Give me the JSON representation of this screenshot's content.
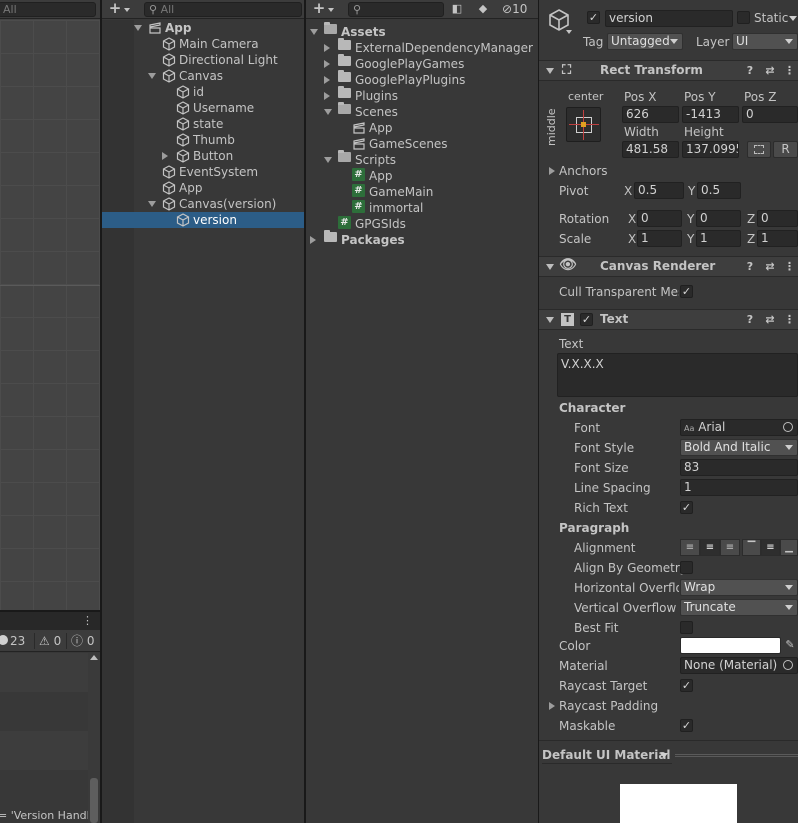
{
  "scene": {
    "search_placeholder": "All"
  },
  "console": {
    "warn_badge_count": "23",
    "warn_count": "0",
    "error_count": "0",
    "log_message": "= 'Version Handl"
  },
  "hierarchy": {
    "search_placeholder": "All",
    "items": [
      {
        "label": "App",
        "depth": 0,
        "expand": "down",
        "icon": "unity-scene-icon",
        "bold": true
      },
      {
        "label": "Main Camera",
        "depth": 1,
        "expand": "",
        "icon": "gameobject-cube-icon"
      },
      {
        "label": "Directional Light",
        "depth": 1,
        "expand": "",
        "icon": "gameobject-cube-icon"
      },
      {
        "label": "Canvas",
        "depth": 1,
        "expand": "down",
        "icon": "gameobject-cube-icon"
      },
      {
        "label": "id",
        "depth": 2,
        "expand": "",
        "icon": "gameobject-cube-icon"
      },
      {
        "label": "Username",
        "depth": 2,
        "expand": "",
        "icon": "gameobject-cube-icon"
      },
      {
        "label": "state",
        "depth": 2,
        "expand": "",
        "icon": "gameobject-cube-icon"
      },
      {
        "label": "Thumb",
        "depth": 2,
        "expand": "",
        "icon": "gameobject-cube-icon"
      },
      {
        "label": "Button",
        "depth": 2,
        "expand": "right",
        "icon": "gameobject-cube-icon"
      },
      {
        "label": "EventSystem",
        "depth": 1,
        "expand": "",
        "icon": "gameobject-cube-icon"
      },
      {
        "label": "App",
        "depth": 1,
        "expand": "",
        "icon": "gameobject-cube-icon"
      },
      {
        "label": "Canvas(version)",
        "depth": 1,
        "expand": "down",
        "icon": "gameobject-cube-icon"
      },
      {
        "label": "version",
        "depth": 2,
        "expand": "",
        "icon": "gameobject-cube-icon",
        "selected": true
      }
    ]
  },
  "project": {
    "hidden_count": "10",
    "items": [
      {
        "label": "Assets",
        "depth": 0,
        "expand": "down",
        "icon": "folder-open-icon",
        "bold": true
      },
      {
        "label": "ExternalDependencyManager",
        "depth": 1,
        "expand": "right",
        "icon": "folder-icon"
      },
      {
        "label": "GooglePlayGames",
        "depth": 1,
        "expand": "right",
        "icon": "folder-icon"
      },
      {
        "label": "GooglePlayPlugins",
        "depth": 1,
        "expand": "right",
        "icon": "folder-icon"
      },
      {
        "label": "Plugins",
        "depth": 1,
        "expand": "right",
        "icon": "folder-icon"
      },
      {
        "label": "Scenes",
        "depth": 1,
        "expand": "down",
        "icon": "folder-open-icon"
      },
      {
        "label": "App",
        "depth": 2,
        "expand": "",
        "icon": "unity-scene-icon"
      },
      {
        "label": "GameScenes",
        "depth": 2,
        "expand": "",
        "icon": "unity-scene-icon"
      },
      {
        "label": "Scripts",
        "depth": 1,
        "expand": "down",
        "icon": "folder-open-icon"
      },
      {
        "label": "App",
        "depth": 2,
        "expand": "",
        "icon": "csharp-script-icon"
      },
      {
        "label": "GameMain",
        "depth": 2,
        "expand": "",
        "icon": "csharp-script-icon"
      },
      {
        "label": "immortal",
        "depth": 2,
        "expand": "",
        "icon": "csharp-script-icon"
      },
      {
        "label": "GPGSIds",
        "depth": 1,
        "expand": "",
        "icon": "csharp-script-icon"
      },
      {
        "label": "Packages",
        "depth": 0,
        "expand": "right",
        "icon": "folder-icon",
        "bold": true
      }
    ]
  },
  "inspector": {
    "name": "version",
    "static_label": "Static",
    "tag_label": "Tag",
    "tag_value": "Untagged",
    "layer_label": "Layer",
    "layer_value": "UI",
    "rect": {
      "title": "Rect Transform",
      "anchor_h": "center",
      "anchor_v": "middle",
      "posx_label": "Pos X",
      "posy_label": "Pos Y",
      "posz_label": "Pos Z",
      "posx": "626",
      "posy": "-1413",
      "posz": "0",
      "width_label": "Width",
      "height_label": "Height",
      "width": "481.58",
      "height": "137.0995",
      "r_button": "R",
      "anchors_label": "Anchors",
      "pivot_label": "Pivot",
      "pivot_x": "0.5",
      "pivot_y": "0.5",
      "rotation_label": "Rotation",
      "rot_x": "0",
      "rot_y": "0",
      "rot_z": "0",
      "scale_label": "Scale",
      "scale_x": "1",
      "scale_y": "1",
      "scale_z": "1",
      "x": "X",
      "y": "Y",
      "z": "Z"
    },
    "canvas_renderer": {
      "title": "Canvas Renderer",
      "cull_label": "Cull Transparent Mes"
    },
    "text": {
      "title": "Text",
      "text_label": "Text",
      "text_value": "V.X.X.X",
      "character_label": "Character",
      "font_label": "Font",
      "font_value": "Arial",
      "font_icon_text": "Aa",
      "font_style_label": "Font Style",
      "font_style_value": "Bold And Italic",
      "font_size_label": "Font Size",
      "font_size_value": "83",
      "line_spacing_label": "Line Spacing",
      "line_spacing_value": "1",
      "rich_text_label": "Rich Text",
      "paragraph_label": "Paragraph",
      "alignment_label": "Alignment",
      "align_geometry_label": "Align By Geometry",
      "hoverflow_label": "Horizontal Overflow",
      "hoverflow_value": "Wrap",
      "voverflow_label": "Vertical Overflow",
      "voverflow_value": "Truncate",
      "best_fit_label": "Best Fit",
      "color_label": "Color",
      "material_label": "Material",
      "material_value": "None (Material)",
      "raycast_target_label": "Raycast Target",
      "raycast_padding_label": "Raycast Padding",
      "maskable_label": "Maskable"
    },
    "material_dropdown": "Default UI Material",
    "colors": {
      "selection": "#2c5d87",
      "text_color_swatch": "#ffffff"
    }
  }
}
